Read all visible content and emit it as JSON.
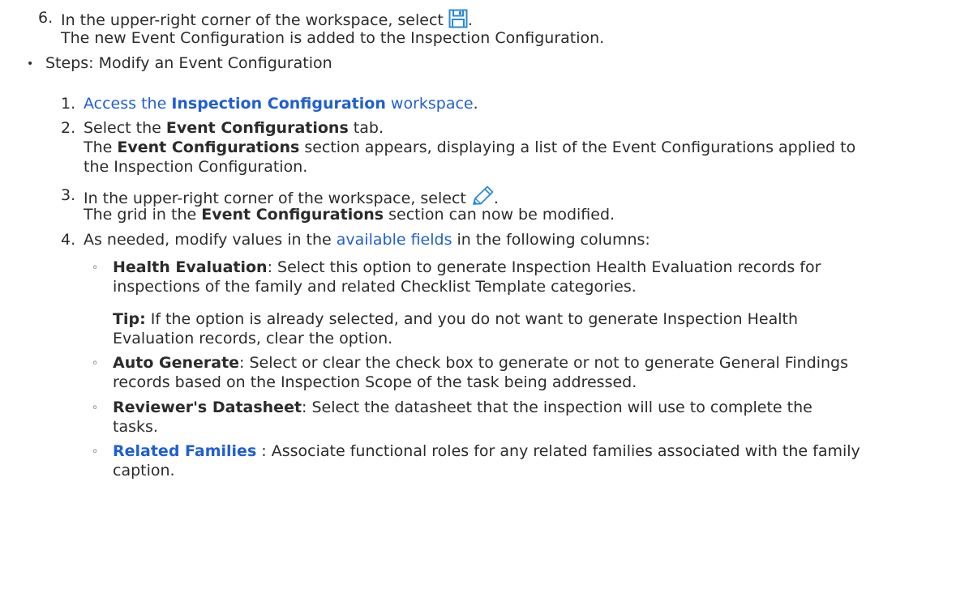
{
  "step6": {
    "number": "6.",
    "text_before": "In the upper-right corner of the workspace, select",
    "icon": "save-icon",
    "text_after": ".",
    "result": "The new Event Configuration is added to the Inspection Configuration."
  },
  "section": {
    "bullet": "•",
    "title": "Steps: Modify an Event Configuration"
  },
  "steps": {
    "s1": {
      "number": "1.",
      "link_pre": "Access the ",
      "link_bold": "Inspection Configuration",
      "link_post": " workspace",
      "end": "."
    },
    "s2": {
      "number": "2.",
      "pre": "Select the ",
      "bold": "Event Configurations",
      "post": " tab.",
      "res_pre": "The ",
      "res_bold": "Event Configurations",
      "res_post": " section appears, displaying a list of the Event Configurations applied to",
      "res_line2": "the Inspection Configuration."
    },
    "s3": {
      "number": "3.",
      "text_before": "In the upper-right corner of the workspace, select",
      "icon": "pencil-icon",
      "text_after": ".",
      "res_pre": "The grid in the ",
      "res_bold": "Event Configurations",
      "res_post": " section can now be modified."
    },
    "s4": {
      "number": "4.",
      "pre": "As needed, modify values in the ",
      "link": "available fields",
      "post": " in the following columns:"
    }
  },
  "sub_items": {
    "marker": "◦",
    "health": {
      "bold": "Health Evaluation",
      "line1": ": Select this option to generate Inspection Health Evaluation records for",
      "line2": "inspections of the family and related Checklist Template categories.",
      "tip_label": "Tip:",
      "tip_line1": " If the option is already selected, and you do not want to generate Inspection Health",
      "tip_line2": "Evaluation records, clear the option."
    },
    "auto": {
      "bold": "Auto Generate",
      "line1": ": Select or clear the check box to generate or not to generate General Findings",
      "line2": "records based on the Inspection Scope of the task being addressed."
    },
    "reviewer": {
      "bold": "Reviewer's Datasheet",
      "line1": ": Select the datasheet that the inspection will use to complete the",
      "line2": "tasks."
    },
    "related": {
      "link": "Related Families",
      "line1": " : Associate functional roles for any related families associated with the family",
      "line2": "caption."
    }
  }
}
